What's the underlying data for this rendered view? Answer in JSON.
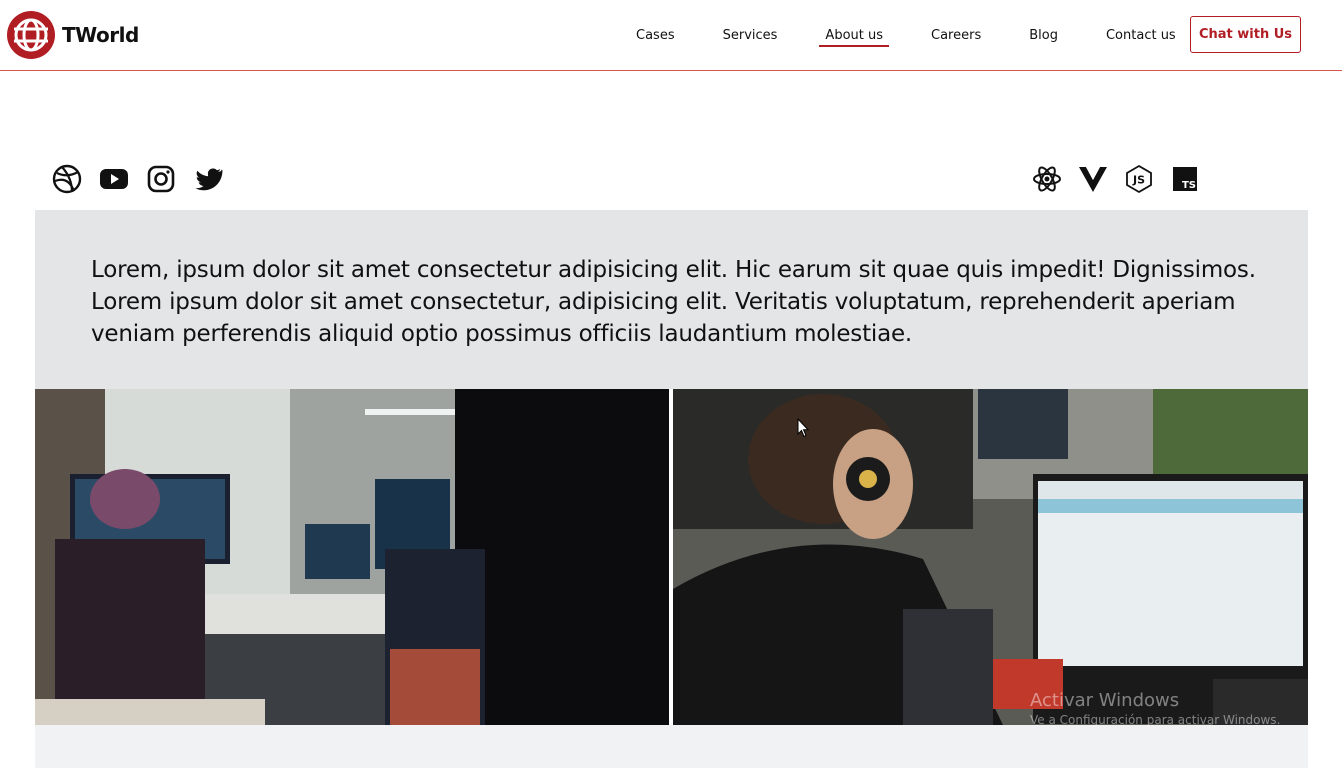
{
  "brand": {
    "name": "TWorld",
    "logo_icon": "globe-logo-icon",
    "accent": "#b01e24"
  },
  "nav": {
    "items": [
      {
        "label": "Cases"
      },
      {
        "label": "Services"
      },
      {
        "label": "About us",
        "active": true
      },
      {
        "label": "Careers"
      },
      {
        "label": "Blog"
      },
      {
        "label": "Contact us"
      }
    ],
    "cta": "Chat with Us"
  },
  "social_icons": [
    "dribbble-icon",
    "youtube-icon",
    "instagram-icon",
    "twitter-icon"
  ],
  "tech_icons": [
    "react-icon",
    "vue-icon",
    "nodejs-icon",
    "typescript-icon"
  ],
  "intro": {
    "text": "Lorem, ipsum dolor sit amet consectetur adipisicing elit. Hic earum sit quae quis impedit! Dignissimos. Lorem ipsum dolor sit amet consectetur, adipisicing elit. Veritatis voluptatum, reprehenderit aperiam veniam perferendis aliquid optio possimus officiis laudantium molestiae."
  },
  "watermark": {
    "line1": "Activar Windows",
    "line2": "Ve a Configuración para activar Windows."
  },
  "colors": {
    "header_border": "#d9534f",
    "intro_bg": "#e4e5e7",
    "bottom_bg": "#f1f2f4"
  }
}
